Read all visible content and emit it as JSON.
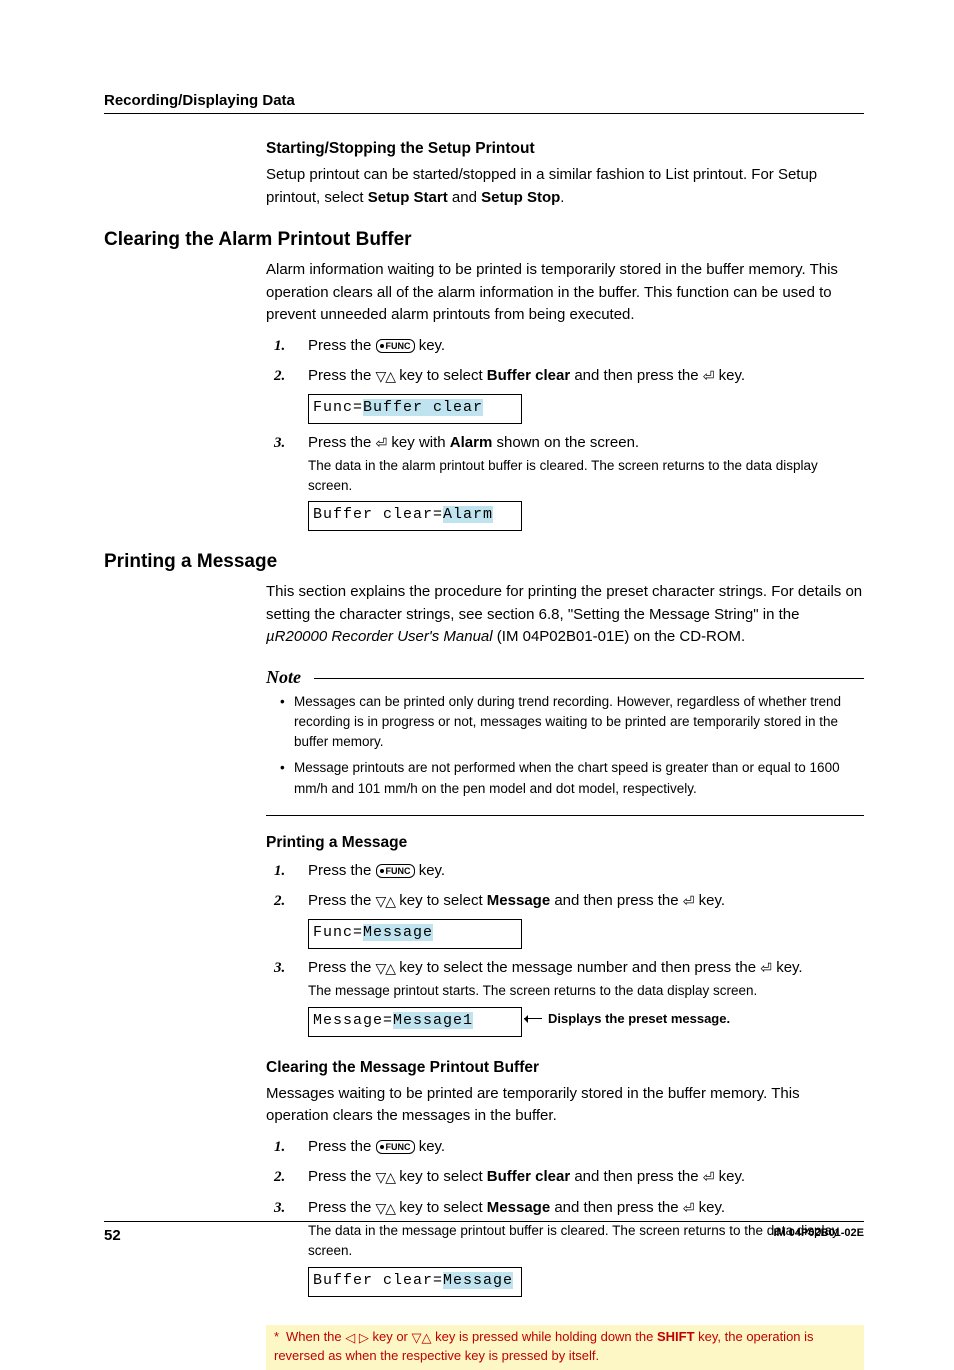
{
  "runningHead": "Recording/Displaying Data",
  "section1": {
    "h4": "Starting/Stopping the Setup Printout",
    "p_pre": "Setup printout can be started/stopped in a similar fashion to List printout. For Setup printout, select ",
    "b1": "Setup Start",
    "mid": " and ",
    "b2": "Setup Stop",
    "post": "."
  },
  "clearAlarm": {
    "h2": "Clearing the Alarm Printout Buffer",
    "intro": "Alarm information waiting to be printed is temporarily stored in the buffer memory. This operation clears all of the alarm information in the buffer. This function can be used to prevent unneeded alarm printouts from being executed.",
    "steps": {
      "s1_a": "Press the ",
      "s1_b": " key.",
      "s2_a": "Press the ",
      "s2_b": " key to select ",
      "s2_bold": "Buffer clear",
      "s2_c": " and then press the ",
      "s2_d": " key.",
      "lcd1_a": "Func=",
      "lcd1_b": "Buffer clear",
      "s3_a": "Press the ",
      "s3_b": " key with ",
      "s3_bold": "Alarm",
      "s3_c": " shown on the screen.",
      "s3_sub": "The data in the alarm printout buffer is cleared. The screen returns to the data display screen.",
      "lcd2_a": "Buffer clear=",
      "lcd2_b": "Alarm"
    }
  },
  "printMsg": {
    "h2": "Printing a Message",
    "intro_a": "This section explains the procedure for printing the preset character strings. For details on setting the character strings, see section 6.8, \"Setting the Message String\" in the ",
    "intro_i": "µR20000 Recorder User's Manual",
    "intro_b": " (IM 04P02B01-01E) on the CD-ROM.",
    "noteHead": "Note",
    "note1": "Messages can be printed only during trend recording. However, regardless of whether trend recording is in progress or not, messages waiting to be printed are temporarily stored in the buffer memory.",
    "note2": "Message printouts are not performed when the chart speed is greater than or equal to 1600 mm/h and 101 mm/h on the pen model and dot model, respectively.",
    "h4": "Printing a Message",
    "steps": {
      "s1_a": "Press the ",
      "s1_b": " key.",
      "s2_a": "Press the ",
      "s2_b": " key to select ",
      "s2_bold": "Message",
      "s2_c": " and then press the ",
      "s2_d": " key.",
      "lcd1_a": "Func=",
      "lcd1_b": "Message",
      "s3_a": "Press the ",
      "s3_b": " key to select the message number and then press the ",
      "s3_c": " key.",
      "s3_sub": "The message printout starts. The screen returns to the data display screen.",
      "lcd2_a": "Message=",
      "lcd2_b": "Message1",
      "msgCaption": "Displays the preset message."
    }
  },
  "clearMsg": {
    "h4": "Clearing the Message Printout Buffer",
    "intro": "Messages waiting to be printed are temporarily stored in the buffer memory. This operation clears the messages in the buffer.",
    "steps": {
      "s1_a": "Press the ",
      "s1_b": " key.",
      "s2_a": "Press the ",
      "s2_b": " key to select ",
      "s2_bold": "Buffer clear",
      "s2_c": " and then press the ",
      "s2_d": " key.",
      "s3_a": "Press the ",
      "s3_b": " key to select ",
      "s3_bold": "Message",
      "s3_c": " and then press the ",
      "s3_d": " key.",
      "s3_sub": "The data in the message printout buffer is cleared. The screen returns to the data display screen.",
      "lcd_a": "Buffer clear=",
      "lcd_b": "Message"
    }
  },
  "shiftNote": {
    "a": "When the ",
    "b": " key or ",
    "c": " key is pressed while holding down the ",
    "bold": "SHIFT",
    "d": " key, the operation is reversed as when the respective key is pressed by itself."
  },
  "footer": {
    "page": "52",
    "doc": "IM 04P02B01-02E"
  },
  "keys": {
    "func": "FUNC"
  }
}
